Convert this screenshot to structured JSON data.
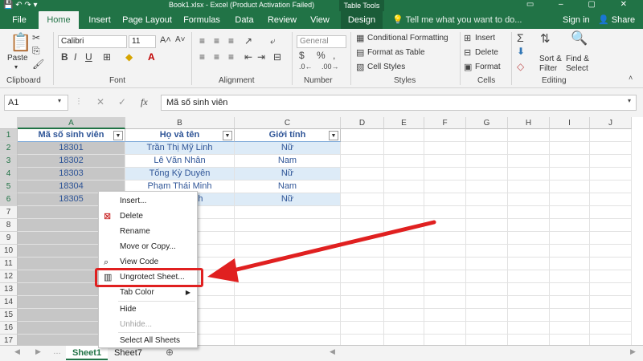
{
  "titlebar": {
    "title": "Book1.xlsx - Excel (Product Activation Failed)",
    "context_tab": "Table Tools"
  },
  "tabs": [
    "File",
    "Home",
    "Insert",
    "Page Layout",
    "Formulas",
    "Data",
    "Review",
    "View",
    "Design"
  ],
  "tell_me": "Tell me what you want to do...",
  "sign_in": "Sign in",
  "share": "Share",
  "ribbon": {
    "clipboard": {
      "paste": "Paste",
      "label": "Clipboard"
    },
    "font": {
      "name": "Calibri",
      "size": "11",
      "label": "Font"
    },
    "alignment": {
      "label": "Alignment"
    },
    "number": {
      "format": "General",
      "label": "Number"
    },
    "styles": {
      "conditional": "Conditional Formatting",
      "format_table": "Format as Table",
      "cell_styles": "Cell Styles",
      "label": "Styles"
    },
    "cells": {
      "insert": "Insert",
      "delete": "Delete",
      "format": "Format",
      "label": "Cells"
    },
    "editing": {
      "sort": "Sort &",
      "filter": "Filter",
      "find": "Find &",
      "select": "Select",
      "label": "Editing"
    }
  },
  "formula_bar": {
    "name_box": "A1",
    "content": "Mã số sinh viên"
  },
  "columns": [
    "A",
    "B",
    "C",
    "D",
    "E",
    "F",
    "G",
    "H",
    "I",
    "J"
  ],
  "rows": [
    "1",
    "2",
    "3",
    "4",
    "5",
    "6",
    "7",
    "8",
    "9",
    "10",
    "11",
    "12",
    "13",
    "14",
    "15",
    "16",
    "17"
  ],
  "table": {
    "headers": [
      "Mã số sinh viên",
      "Họ và tên",
      "Giới tính"
    ],
    "rows": [
      [
        "18301",
        "Trần Thị Mỹ Linh",
        "Nữ"
      ],
      [
        "18302",
        "Lê Văn Nhân",
        "Nam"
      ],
      [
        "18303",
        "Tống Kỳ Duyên",
        "Nữ"
      ],
      [
        "18304",
        "Phạm Thái Minh",
        "Nam"
      ],
      [
        "18305",
        "...hư Quỳnh",
        "Nữ"
      ]
    ]
  },
  "context_menu": {
    "items": [
      {
        "label": "Insert...",
        "icon": ""
      },
      {
        "label": "Delete",
        "icon": "delete-icon"
      },
      {
        "label": "Rename",
        "icon": ""
      },
      {
        "label": "Move or Copy...",
        "icon": ""
      },
      {
        "label": "View Code",
        "icon": "view-code-icon"
      },
      {
        "label": "Ungrotect Sheet...",
        "icon": "unprotect-icon"
      },
      {
        "label": "Tab Color",
        "icon": ""
      },
      {
        "label": "Hide",
        "icon": ""
      },
      {
        "label": "Unhide...",
        "icon": ""
      },
      {
        "label": "Select All Sheets",
        "icon": ""
      }
    ]
  },
  "sheets": [
    "Sheet1",
    "Sheet7"
  ],
  "colors": {
    "excel_green": "#217346",
    "highlight_red": "#e02020",
    "table_band": "#ddebf7"
  }
}
